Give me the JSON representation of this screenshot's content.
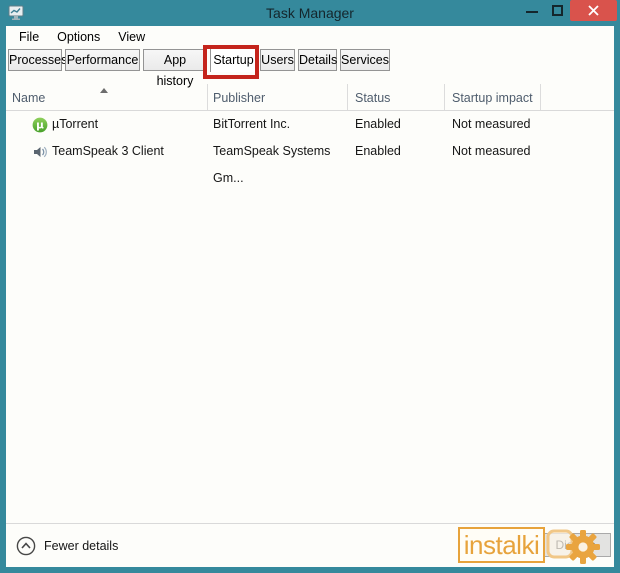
{
  "window": {
    "title": "Task Manager"
  },
  "menubar": {
    "items": [
      {
        "label": "File"
      },
      {
        "label": "Options"
      },
      {
        "label": "View"
      }
    ]
  },
  "tabs": {
    "active": "Startup",
    "items": [
      {
        "label": "Processes"
      },
      {
        "label": "Performance"
      },
      {
        "label": "App history"
      },
      {
        "label": "Startup"
      },
      {
        "label": "Users"
      },
      {
        "label": "Details"
      },
      {
        "label": "Services"
      }
    ]
  },
  "table": {
    "columns": [
      {
        "label": "Name",
        "sort": "ascending"
      },
      {
        "label": "Publisher"
      },
      {
        "label": "Status"
      },
      {
        "label": "Startup impact"
      }
    ],
    "rows": [
      {
        "icon": "utorrent-icon",
        "name": "µTorrent",
        "publisher": "BitTorrent Inc.",
        "status": "Enabled",
        "impact": "Not measured"
      },
      {
        "icon": "teamspeak-icon",
        "name": "TeamSpeak 3 Client",
        "publisher": "TeamSpeak Systems Gm...",
        "status": "Enabled",
        "impact": "Not measured"
      }
    ]
  },
  "footer": {
    "toggle_label": "Fewer details",
    "disable_button_label": "Disable"
  },
  "watermark": {
    "text": "instalki"
  },
  "annotation": {
    "type": "highlight-box",
    "target": "Startup tab",
    "color": "#c4241c"
  },
  "colors": {
    "frame_teal": "#35899c",
    "close_red": "#d9534c",
    "annotation_red": "#c4241c",
    "watermark_orange": "#e7a33c",
    "header_text": "#4f5d6d"
  }
}
